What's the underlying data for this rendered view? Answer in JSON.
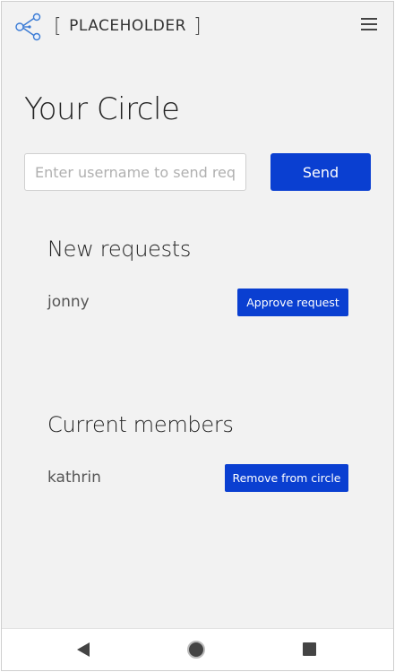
{
  "header": {
    "bracket_left": "[",
    "brand": "PLACEHOLDER",
    "bracket_right": "]",
    "logo_icon": "share-network-icon",
    "menu_icon": "hamburger-menu-icon"
  },
  "page": {
    "title": "Your Circle"
  },
  "search": {
    "placeholder": "Enter username to send request",
    "value": "",
    "send_label": "Send"
  },
  "new_requests": {
    "title": "New requests",
    "items": [
      {
        "username": "jonny",
        "action_label": "Approve request"
      }
    ]
  },
  "current_members": {
    "title": "Current members",
    "items": [
      {
        "username": "kathrin",
        "action_label": "Remove from circle"
      }
    ]
  },
  "navbar": {
    "back_icon": "back-triangle-icon",
    "home_icon": "home-circle-icon",
    "recent_icon": "recent-apps-square-icon"
  },
  "colors": {
    "accent": "#0a3fd1",
    "background": "#f2f2f2"
  }
}
